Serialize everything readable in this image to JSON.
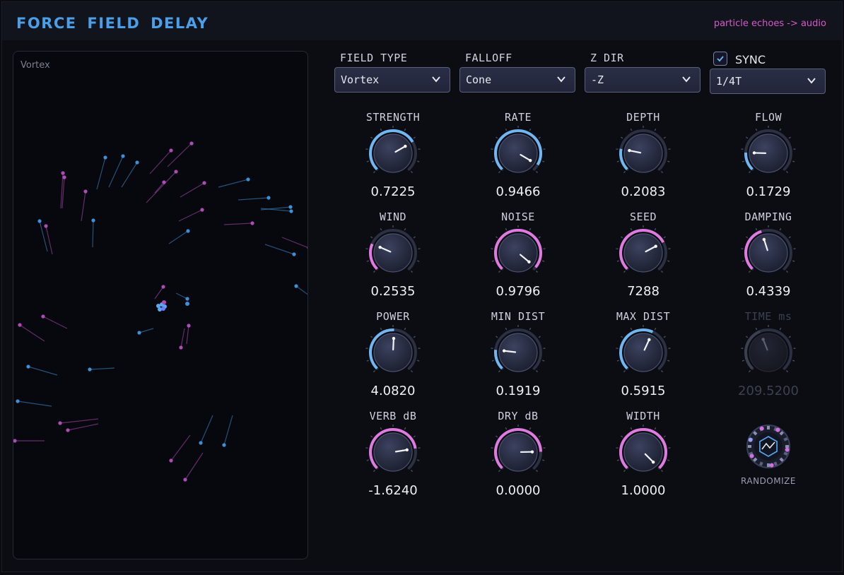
{
  "header": {
    "title": "FORCE FIELD DELAY",
    "subtitle": "particle echoes -> audio"
  },
  "viz": {
    "label": "Vortex"
  },
  "dropdowns": [
    {
      "label": "FIELD TYPE",
      "value": "Vortex"
    },
    {
      "label": "FALLOFF",
      "value": "Cone"
    },
    {
      "label": "Z DIR",
      "value": "-Z"
    }
  ],
  "sync": {
    "label": "SYNC",
    "checked": true,
    "value": "1/4T"
  },
  "knobs": [
    {
      "label": "STRENGTH",
      "value": "0.7225",
      "fraction": 0.7225,
      "color": "#6fb6f2"
    },
    {
      "label": "RATE",
      "value": "0.9466",
      "fraction": 0.9466,
      "color": "#6fb6f2"
    },
    {
      "label": "DEPTH",
      "value": "0.2083",
      "fraction": 0.2083,
      "color": "#6fb6f2"
    },
    {
      "label": "FLOW",
      "value": "0.1729",
      "fraction": 0.1729,
      "color": "#6fb6f2"
    },
    {
      "label": "WIND",
      "value": "0.2535",
      "fraction": 0.2535,
      "color": "#e07ae0"
    },
    {
      "label": "NOISE",
      "value": "0.9796",
      "fraction": 0.9796,
      "color": "#e07ae0"
    },
    {
      "label": "SEED",
      "value": "7288",
      "fraction": 0.73,
      "color": "#e07ae0"
    },
    {
      "label": "DAMPING",
      "value": "0.4339",
      "fraction": 0.4339,
      "color": "#e07ae0"
    },
    {
      "label": "POWER",
      "value": "4.0820",
      "fraction": 0.51,
      "color": "#6fb6f2"
    },
    {
      "label": "MIN DIST",
      "value": "0.1919",
      "fraction": 0.1919,
      "color": "#6fb6f2"
    },
    {
      "label": "MAX DIST",
      "value": "0.5915",
      "fraction": 0.5915,
      "color": "#6fb6f2"
    },
    {
      "label": "TIME ms",
      "value": "209.5200",
      "fraction": 0.42,
      "color": "#3a4050",
      "disabled": true
    },
    {
      "label": "VERB dB",
      "value": "-1.6240",
      "fraction": 0.8,
      "color": "#e07ae0"
    },
    {
      "label": "DRY dB",
      "value": "0.0000",
      "fraction": 0.83,
      "color": "#e07ae0"
    },
    {
      "label": "WIDTH",
      "value": "1.0000",
      "fraction": 1.0,
      "color": "#e07ae0"
    }
  ],
  "randomize": {
    "label": "RANDOMIZE"
  },
  "colors": {
    "accent_blue": "#4a9fe8",
    "accent_pink": "#d55ac9"
  }
}
